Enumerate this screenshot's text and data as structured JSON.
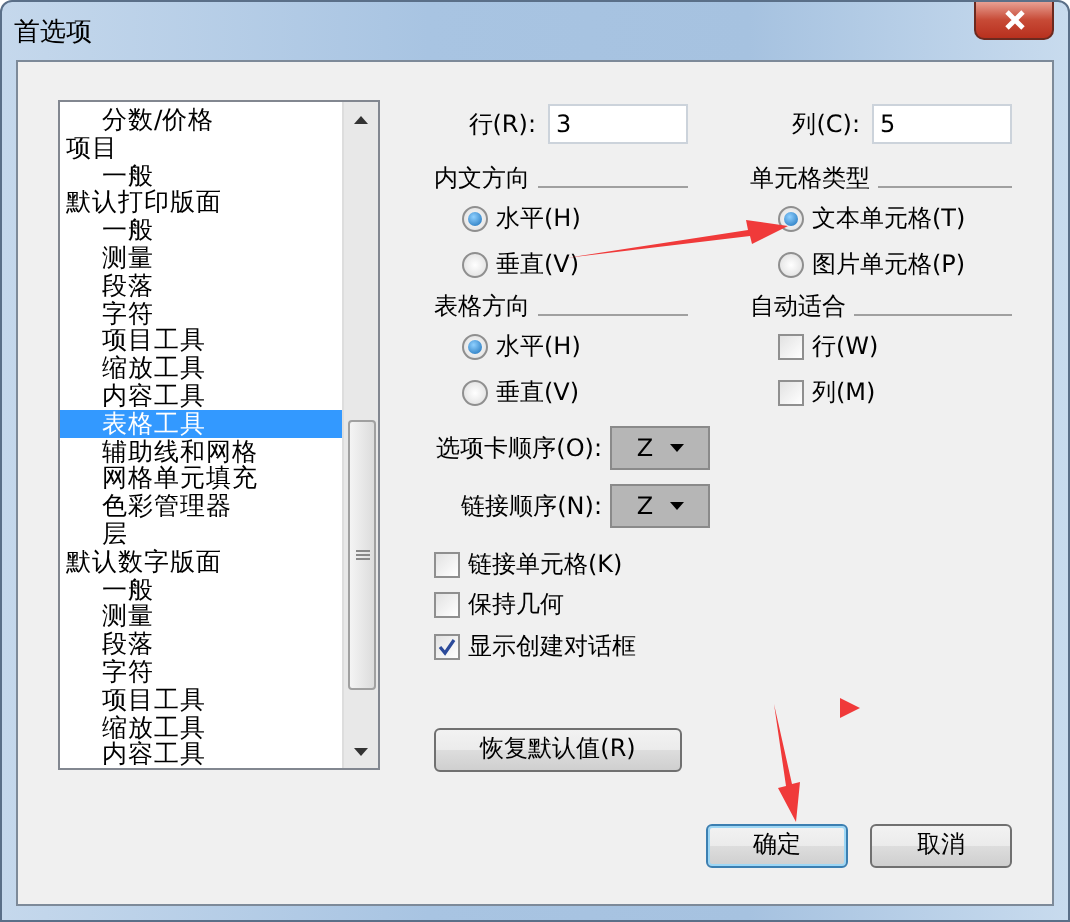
{
  "window": {
    "title": "首选项"
  },
  "sidebar": {
    "items": [
      {
        "children": [
          {
            "label": "分数/价格",
            "selected": false
          }
        ]
      },
      {
        "label": "项目",
        "selected": false,
        "children": [
          {
            "label": "一般",
            "selected": false
          }
        ]
      },
      {
        "label": "默认打印版面",
        "selected": false,
        "children": [
          {
            "label": "一般",
            "selected": false
          },
          {
            "label": "测量",
            "selected": false
          },
          {
            "label": "段落",
            "selected": false
          },
          {
            "label": "字符",
            "selected": false
          },
          {
            "label": "项目工具",
            "selected": false
          },
          {
            "label": "缩放工具",
            "selected": false
          },
          {
            "label": "内容工具",
            "selected": false
          },
          {
            "label": "表格工具",
            "selected": true
          },
          {
            "label": "辅助线和网格",
            "selected": false
          },
          {
            "label": "网格单元填充",
            "selected": false
          },
          {
            "label": "色彩管理器",
            "selected": false
          },
          {
            "label": "层",
            "selected": false
          }
        ]
      },
      {
        "label": "默认数字版面",
        "selected": false,
        "children": [
          {
            "label": "一般",
            "selected": false
          },
          {
            "label": "测量",
            "selected": false
          },
          {
            "label": "段落",
            "selected": false
          },
          {
            "label": "字符",
            "selected": false
          },
          {
            "label": "项目工具",
            "selected": false
          },
          {
            "label": "缩放工具",
            "selected": false
          },
          {
            "label": "内容工具",
            "selected": false
          }
        ]
      }
    ]
  },
  "table_settings": {
    "rows": {
      "label": "行(R):",
      "value": "3"
    },
    "columns": {
      "label": "列(C):",
      "value": "5"
    },
    "text_direction": {
      "title": "内文方向",
      "options": [
        {
          "label": "水平(H)",
          "selected": true
        },
        {
          "label": "垂直(V)",
          "selected": false
        }
      ]
    },
    "cell_type": {
      "title": "单元格类型",
      "options": [
        {
          "label": "文本单元格(T)",
          "selected": true
        },
        {
          "label": "图片单元格(P)",
          "selected": false
        }
      ]
    },
    "table_direction": {
      "title": "表格方向",
      "options": [
        {
          "label": "水平(H)",
          "selected": true
        },
        {
          "label": "垂直(V)",
          "selected": false
        }
      ]
    },
    "auto_fit": {
      "title": "自动适合",
      "options": [
        {
          "label": "行(W)",
          "checked": false
        },
        {
          "label": "列(M)",
          "checked": false
        }
      ]
    },
    "tab_order": {
      "label": "选项卡顺序(O):",
      "value": "Z"
    },
    "link_order": {
      "label": "链接顺序(N):",
      "value": "Z"
    },
    "checkboxes": [
      {
        "label": "链接单元格(K)",
        "checked": false
      },
      {
        "label": "保持几何",
        "checked": false
      },
      {
        "label": "显示创建对话框",
        "checked": true
      }
    ],
    "reset_button": "恢复默认值(R)"
  },
  "buttons": [
    {
      "label": "确定",
      "focused": true
    },
    {
      "label": "取消",
      "focused": false
    }
  ]
}
